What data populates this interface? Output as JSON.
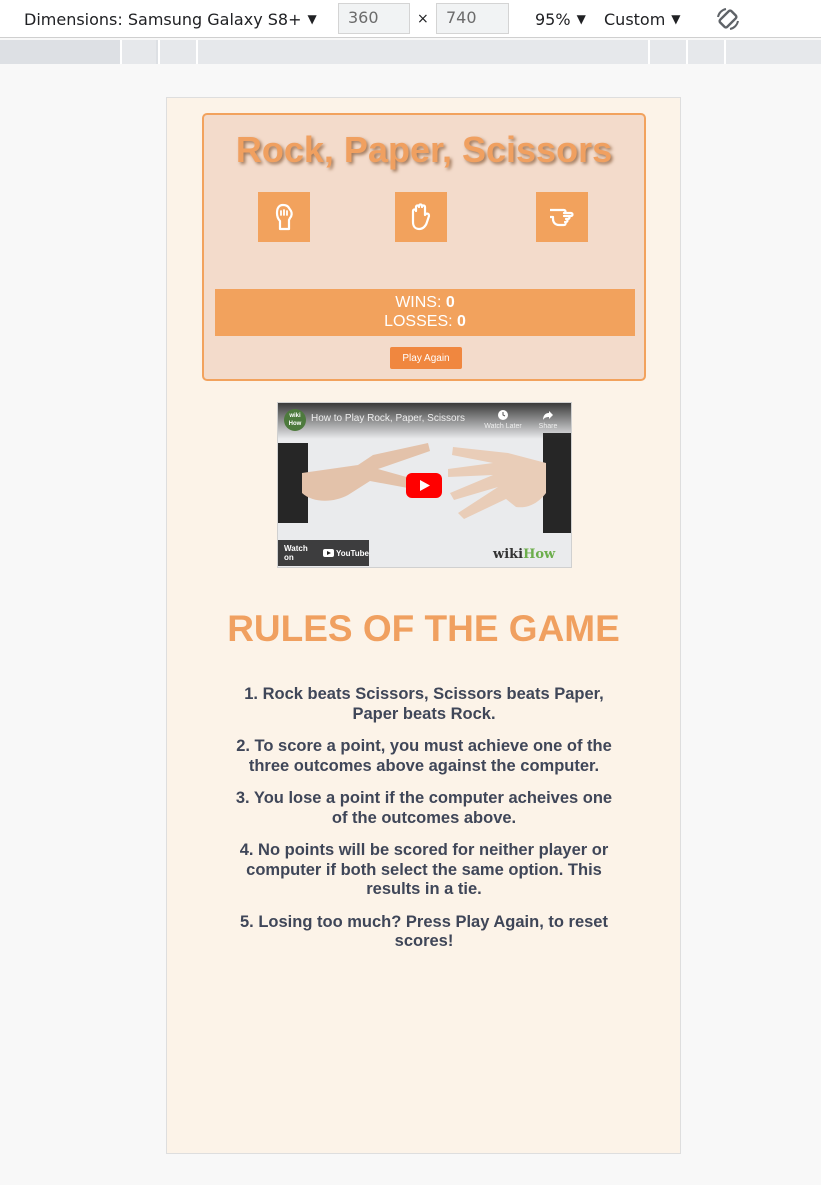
{
  "devtools": {
    "dimensions_label": "Dimensions: Samsung Galaxy S8+",
    "width_value": "360",
    "times_sign": "×",
    "height_value": "740",
    "zoom": "95%",
    "throttle": "Custom",
    "rotate_icon": "rotate-icon"
  },
  "game": {
    "title": "Rock, Paper, Scissors",
    "choices": [
      {
        "name": "rock",
        "icon": "hand-rock-icon"
      },
      {
        "name": "paper",
        "icon": "hand-paper-icon"
      },
      {
        "name": "scissors",
        "icon": "hand-scissors-icon"
      }
    ],
    "wins_label": "WINS:",
    "wins_value": "0",
    "losses_label": "LOSSES:",
    "losses_value": "0",
    "play_again_label": "Play Again"
  },
  "video": {
    "channel_logo_text": "wiki How",
    "title": "How to Play Rock, Paper, Scissors",
    "watch_later_label": "Watch Later",
    "share_label": "Share",
    "watch_on_label": "Watch on",
    "youtube_label": "YouTube",
    "brand_prefix": "wiki",
    "brand_suffix": "How"
  },
  "rules": {
    "title": "RULES OF THE GAME",
    "items": [
      "1. Rock beats Scissors, Scissors beats Paper, Paper beats Rock.",
      "2. To score a point, you must achieve one of the three outcomes above against the computer.",
      "3. You lose a point if the computer acheives one of the outcomes above.",
      "4. No points will be scored for neither player or computer if both select the same option. This results in a tie.",
      "5. Losing too much? Press Play Again, to reset scores!"
    ]
  },
  "colors": {
    "accent": "#f2a25d",
    "title": "#f0a060",
    "page_bg": "#fcf3e8",
    "panel_bg": "#f3dbcb",
    "text": "#3f4658"
  }
}
